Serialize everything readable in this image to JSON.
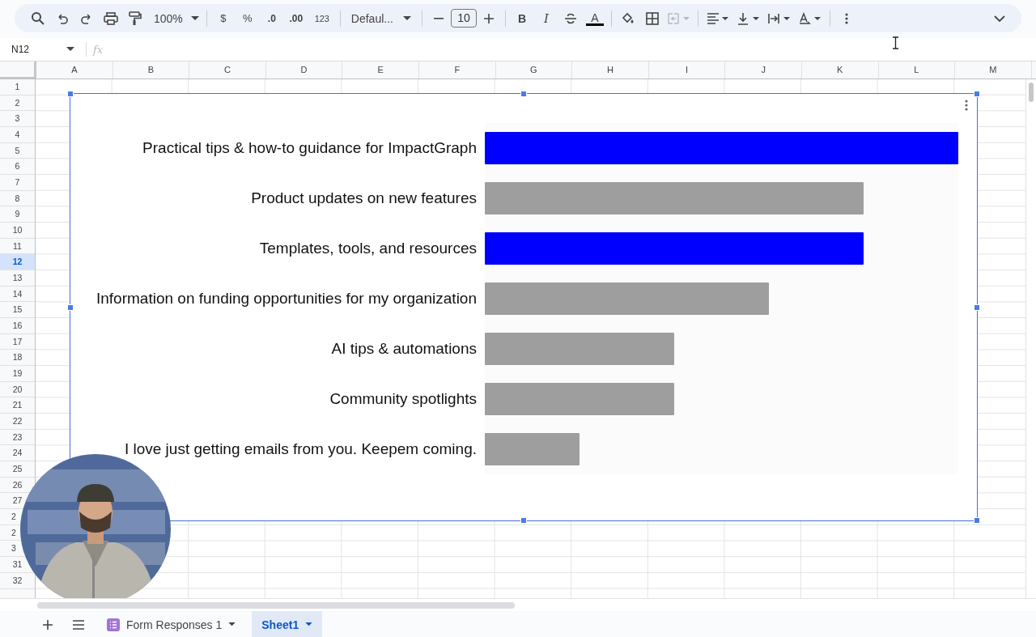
{
  "toolbar": {
    "zoom": "100%",
    "currency": "$",
    "percent": "%",
    "decrease_decimals": ".0",
    "increase_decimals": ".00",
    "number_format": "123",
    "font": "Defaul...",
    "font_size": "10",
    "bold": "B",
    "italic": "I",
    "text_color": "A",
    "merge_disabled": true
  },
  "formula_bar": {
    "name_box": "N12",
    "fx": "fx"
  },
  "columns": [
    "A",
    "B",
    "C",
    "D",
    "E",
    "F",
    "G",
    "H",
    "I",
    "J",
    "K",
    "L",
    "M"
  ],
  "rows": [
    {
      "label": "1",
      "selected": false
    },
    {
      "label": "2",
      "selected": false
    },
    {
      "label": "3",
      "selected": false
    },
    {
      "label": "4",
      "selected": false
    },
    {
      "label": "5",
      "selected": false
    },
    {
      "label": "6",
      "selected": false
    },
    {
      "label": "7",
      "selected": false
    },
    {
      "label": "8",
      "selected": false
    },
    {
      "label": "9",
      "selected": false
    },
    {
      "label": "10",
      "selected": false
    },
    {
      "label": "11",
      "selected": false
    },
    {
      "label": "12",
      "selected": true
    },
    {
      "label": "13",
      "selected": false
    },
    {
      "label": "14",
      "selected": false
    },
    {
      "label": "15",
      "selected": false
    },
    {
      "label": "16",
      "selected": false
    },
    {
      "label": "17",
      "selected": false
    },
    {
      "label": "18",
      "selected": false
    },
    {
      "label": "19",
      "selected": false
    },
    {
      "label": "20",
      "selected": false
    },
    {
      "label": "21",
      "selected": false
    },
    {
      "label": "22",
      "selected": false
    },
    {
      "label": "23",
      "selected": false
    },
    {
      "label": "24",
      "selected": false
    },
    {
      "label": "25",
      "selected": false
    },
    {
      "label": "26",
      "selected": false
    },
    {
      "label": "27",
      "selected": false
    },
    {
      "label": "2",
      "selected": false,
      "cut": true
    },
    {
      "label": "2",
      "selected": false,
      "cut": true
    },
    {
      "label": "3",
      "selected": false,
      "cut": true
    },
    {
      "label": "31",
      "selected": false
    },
    {
      "label": "32",
      "selected": false
    }
  ],
  "chart": {
    "bars": [
      {
        "label": "Practical tips & how-to guidance for ImpactGraph",
        "level": 1,
        "color": "#0000ff"
      },
      {
        "label": "Product updates on new features",
        "level": 0.8,
        "color": "#9e9e9e"
      },
      {
        "label": "Templates, tools, and resources",
        "level": 0.8,
        "color": "#0000ff"
      },
      {
        "label": "Information on funding opportunities for my organization",
        "level": 0.6,
        "color": "#9e9e9e"
      },
      {
        "label": "AI tips & automations",
        "level": 0.4,
        "color": "#9e9e9e"
      },
      {
        "label": "Community spotlights",
        "level": 0.4,
        "color": "#9e9e9e"
      },
      {
        "label": "I love just getting emails from you. Keepem coming.",
        "level": 0.2,
        "color": "#9e9e9e"
      }
    ]
  },
  "sheet_tabs": [
    {
      "label": "Form Responses 1",
      "selected": false,
      "kind": "form"
    },
    {
      "label": "Sheet1",
      "selected": true,
      "kind": "plain"
    }
  ]
}
